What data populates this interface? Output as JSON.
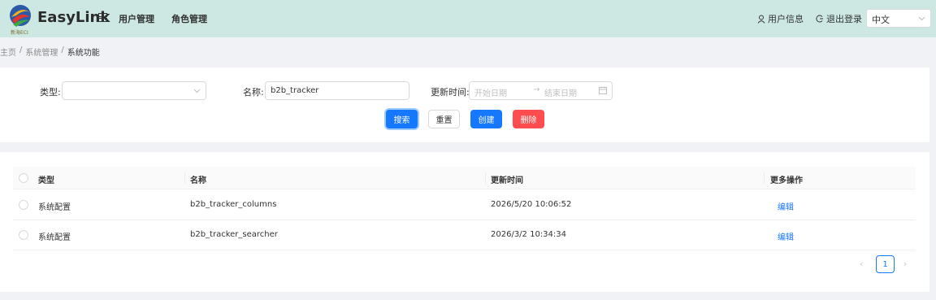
{
  "header": {
    "logo_sub": "新海ECI",
    "brand": "EasyLink",
    "nav": [
      "用户管理",
      "角色管理"
    ],
    "user_info": "用户信息",
    "logout": "退出登录",
    "language": "中文"
  },
  "breadcrumb": [
    "主页",
    "/",
    "系统管理",
    "/",
    "系统功能"
  ],
  "filter": {
    "type_label": "类型:",
    "type_value": "",
    "name_label": "名称:",
    "name_value": "b2b_tracker",
    "updated_label": "更新时间:",
    "start_placeholder": "开始日期",
    "arrow": "→",
    "end_placeholder": "结束日期",
    "buttons": {
      "search": "搜索",
      "reset": "重置",
      "create": "创建",
      "delete": "删除"
    }
  },
  "table": {
    "columns": [
      "类型",
      "名称",
      "更新时间",
      "更多操作"
    ],
    "rows": [
      {
        "type": "系统配置",
        "name": "b2b_tracker_columns",
        "updated": "2026/5/20 10:06:52",
        "action": "编辑"
      },
      {
        "type": "系统配置",
        "name": "b2b_tracker_searcher",
        "updated": "2026/3/2 10:34:34",
        "action": "编辑"
      }
    ]
  },
  "pagination": {
    "current_page": "1",
    "prev": "‹",
    "next": "›"
  },
  "colors": {
    "header_bg": "#cde8e3",
    "primary": "#1677ff",
    "danger": "#ff4d4f"
  }
}
